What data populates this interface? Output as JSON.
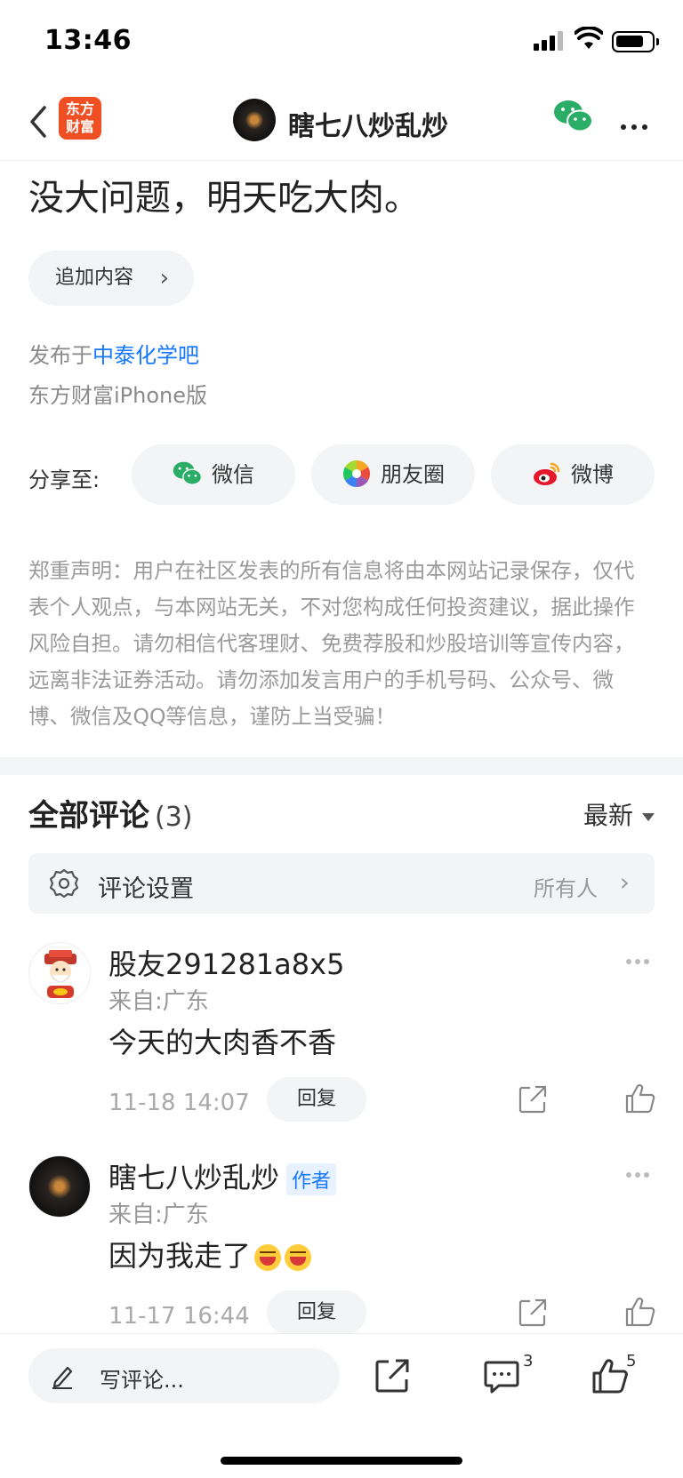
{
  "status_bar": {
    "time": "13:46"
  },
  "nav": {
    "logo_text_line1": "东方",
    "logo_text_line2": "财富",
    "title": "瞎七八炒乱炒",
    "back_icon": "chevron-left-icon",
    "wechat_icon": "wechat-icon",
    "more_icon": "more-icon"
  },
  "post": {
    "headline": "没大问题，明天吃大肉。",
    "add_content_label": "追加内容",
    "published_prefix": "发布于",
    "published_forum": "中泰化学吧",
    "device": "东方财富iPhone版"
  },
  "share": {
    "label": "分享至:",
    "items": [
      {
        "label": "微信",
        "icon": "wechat-icon"
      },
      {
        "label": "朋友圈",
        "icon": "moments-icon"
      },
      {
        "label": "微博",
        "icon": "weibo-icon"
      }
    ]
  },
  "disclaimer": "郑重声明：用户在社区发表的所有信息将由本网站记录保存，仅代表个人观点，与本网站无关，不对您构成任何投资建议，据此操作风险自担。请勿相信代客理财、免费荐股和炒股培训等宣传内容，远离非法证券活动。请勿添加发言用户的手机号码、公众号、微博、微信及QQ等信息，谨防上当受骗！",
  "comments": {
    "title": "全部评论",
    "count": "(3)",
    "sort_label": "最新",
    "settings_label": "评论设置",
    "settings_value": "所有人",
    "reply_label": "回复",
    "items": [
      {
        "name": "股友291281a8x5",
        "badge": "",
        "location": "来自:广东",
        "text": "今天的大肉香不香",
        "date": "11-18 14:07"
      },
      {
        "name": "瞎七八炒乱炒",
        "badge": "作者",
        "location": "来自:广东",
        "text": "因为我走了",
        "emojis": 2,
        "date": "11-17 16:44"
      }
    ]
  },
  "bottom_bar": {
    "write_placeholder": "写评论...",
    "comment_count": "3",
    "like_count": "5"
  },
  "colors": {
    "accent_blue": "#1677ff",
    "brand_orange": "#f04e23",
    "wechat_green": "#2aae67"
  }
}
